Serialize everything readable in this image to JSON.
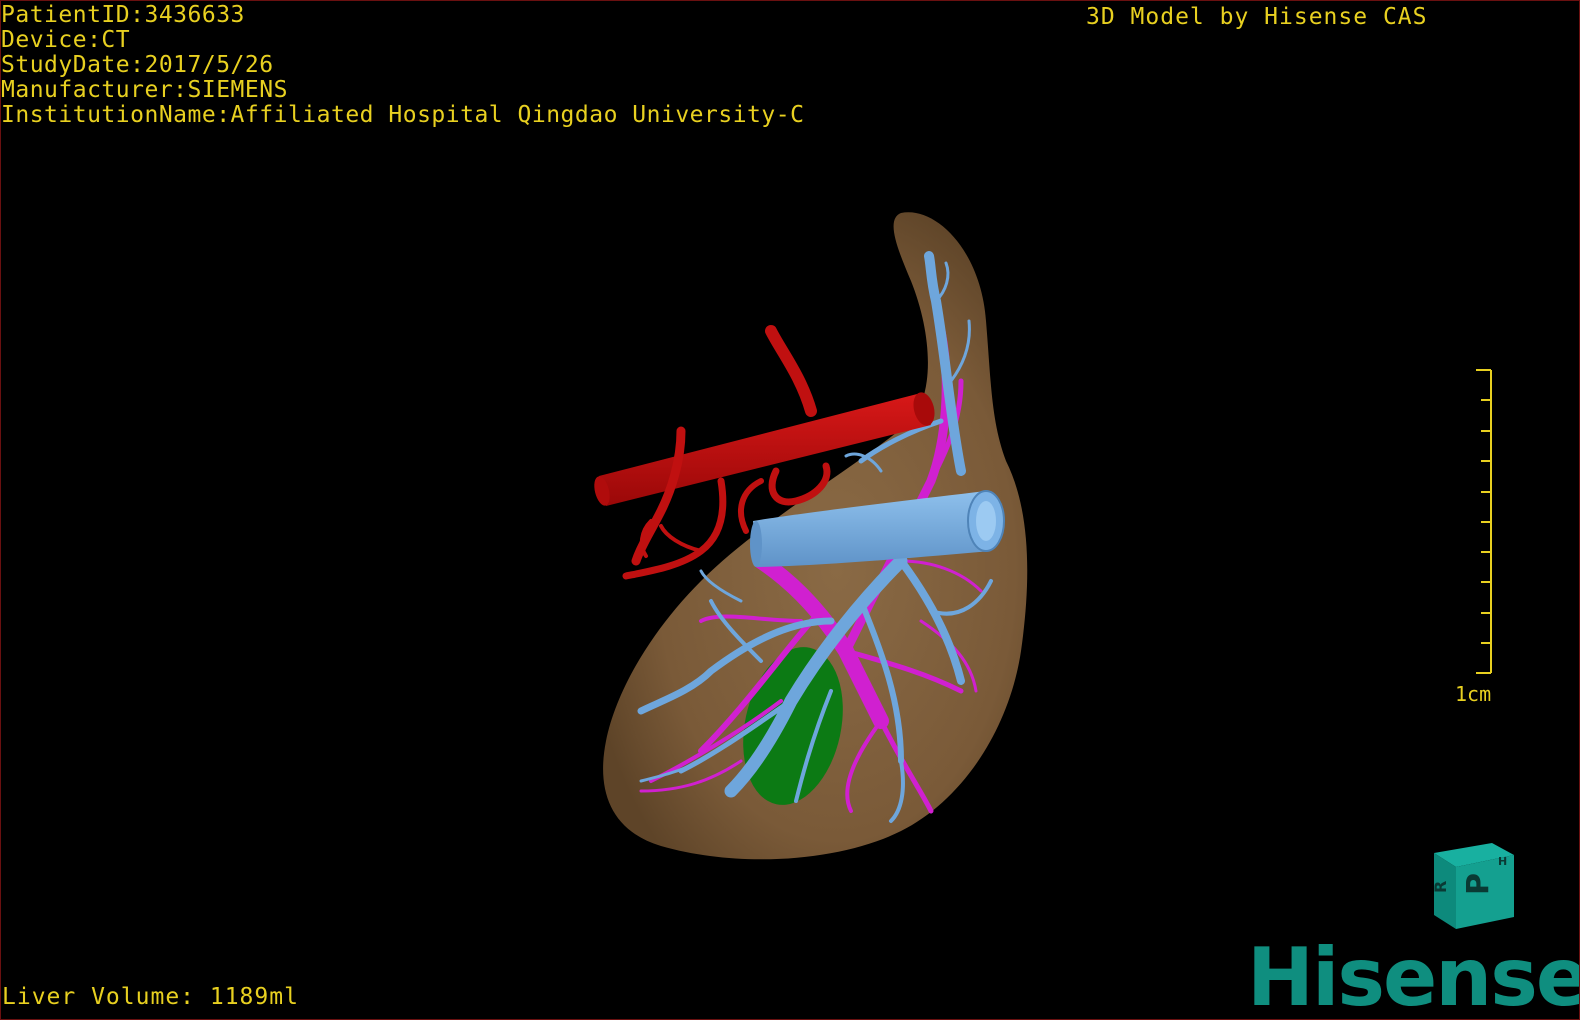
{
  "header": {
    "info_lines": [
      "PatientID:3436633",
      "Device:CT",
      "StudyDate:2017/5/26",
      "Manufacturer:SIEMENS",
      "InstitutionName:Affiliated Hospital Qingdao University-C"
    ],
    "credit": "3D Model by Hisense CAS"
  },
  "footer": {
    "volume": "Liver Volume: 1189ml"
  },
  "scale_bar": {
    "label": "1cm",
    "ticks": 10
  },
  "orientation_cube": {
    "front_letter": "P",
    "side_letter": "R",
    "top_letter": "H"
  },
  "branding": {
    "logo_text": "Hisense"
  },
  "colors": {
    "overlay_text": "#e8d020",
    "liver": "#7a5a38",
    "artery": "#c01010",
    "portal_vein": "#d020d0",
    "hepatic_vein": "#6ea6dc",
    "gallbladder": "#0c7a14",
    "logo": "#0f8e7f"
  },
  "model_structures": [
    "liver",
    "aorta",
    "hepatic_artery",
    "portal_vein",
    "hepatic_vein",
    "vena_cava",
    "gallbladder"
  ]
}
